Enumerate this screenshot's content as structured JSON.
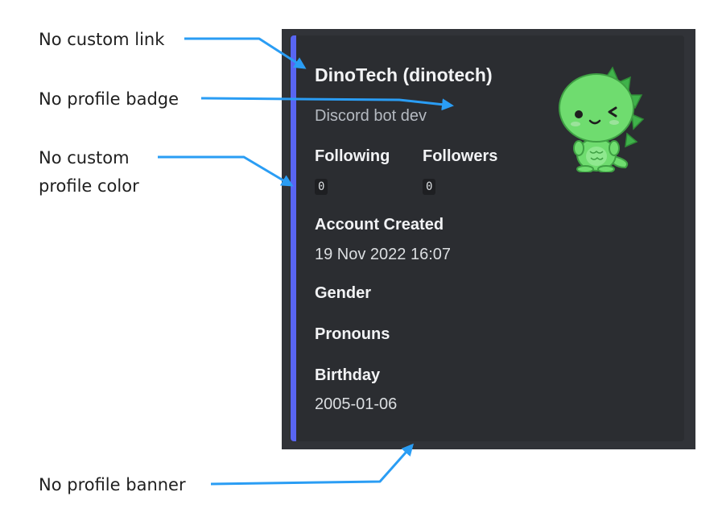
{
  "annotations": {
    "no_custom_link": "No custom link",
    "no_profile_badge": "No profile badge",
    "no_custom_profile_color_line1": "No custom",
    "no_custom_profile_color_line2": "profile color",
    "no_profile_banner": "No profile banner"
  },
  "profile": {
    "display_name": "DinoTech (dinotech)",
    "bio": "Discord bot dev",
    "following_label": "Following",
    "following_value": "0",
    "followers_label": "Followers",
    "followers_value": "0",
    "account_created_label": "Account Created",
    "account_created_value": "19 Nov 2022 16:07",
    "gender_label": "Gender",
    "pronouns_label": "Pronouns",
    "birthday_label": "Birthday",
    "birthday_value": "2005-01-06"
  },
  "colors": {
    "accent": "#5865f2",
    "card": "#2b2d31",
    "arrow": "#2a9df4",
    "dino": "#6fdc6f"
  },
  "icons": {
    "avatar": "dinosaur-avatar-icon"
  }
}
